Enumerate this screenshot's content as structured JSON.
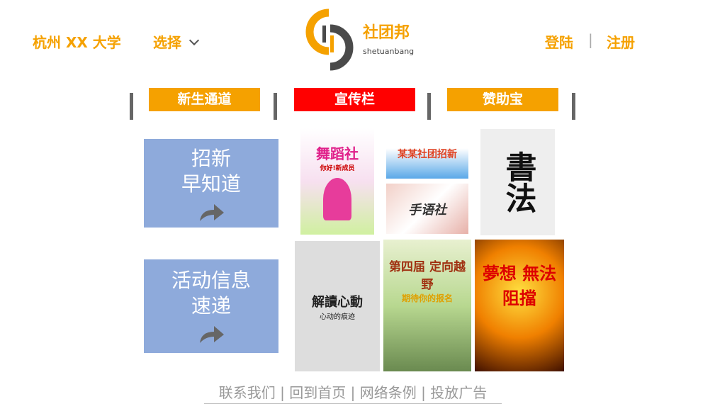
{
  "header": {
    "school": "杭州  XX  大学",
    "select_label": "选择",
    "logo_cn": "社团邦",
    "logo_en": "shetuanbang",
    "login": "登陆",
    "register": "注册",
    "divider": "|"
  },
  "nav": {
    "tabs": [
      {
        "label": "新生通道",
        "color": "#f5a100"
      },
      {
        "label": "宣传栏",
        "color": "#ff0000",
        "active": true
      },
      {
        "label": "赞助宝",
        "color": "#f5a100"
      }
    ]
  },
  "cards": [
    {
      "line1": "招新",
      "line2": "早知道",
      "icon": "share-arrow-icon"
    },
    {
      "line1": "活动信息",
      "line2": "速递",
      "icon": "share-arrow-icon"
    }
  ],
  "posters": [
    {
      "title": "舞蹈社",
      "sub": "你好!新成员"
    },
    {
      "title": "某某社团招新",
      "sub": ""
    },
    {
      "title": "手语社",
      "sub": ""
    },
    {
      "title": "書法",
      "sub": ""
    },
    {
      "title": "解讀心動",
      "sub": "心动的痕迹"
    },
    {
      "title": "第四届 定向越野",
      "sub": "期待你的报名"
    },
    {
      "title": "夢想 無法阻擋",
      "sub": ""
    }
  ],
  "footer": {
    "links": [
      "联系我们",
      "回到首页",
      "网络条例",
      "投放广告"
    ],
    "sep": "|"
  }
}
